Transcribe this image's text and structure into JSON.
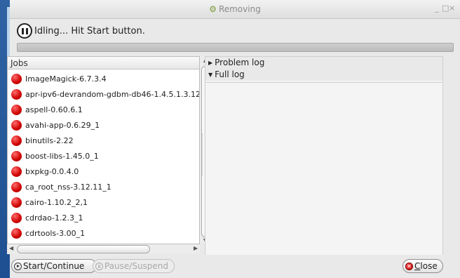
{
  "window": {
    "title": "Removing",
    "title_icon": "gear-removing-icon",
    "controls": {
      "minimize": "_",
      "maximize": "□",
      "close": "×"
    }
  },
  "status": {
    "icon": "pause-circle-icon",
    "text": "Idling... Hit Start button."
  },
  "progress": {
    "fraction": 0.0
  },
  "jobs": {
    "header": "Jobs",
    "items": [
      {
        "label": "ImageMagick-6.7.3.4",
        "status_icon": "red-ball-icon"
      },
      {
        "label": "apr-ipv6-devrandom-gdbm-db46-1.4.5.1.3.12",
        "status_icon": "red-ball-icon"
      },
      {
        "label": "aspell-0.60.6.1",
        "status_icon": "red-ball-icon"
      },
      {
        "label": "avahi-app-0.6.29_1",
        "status_icon": "red-ball-icon"
      },
      {
        "label": "binutils-2.22",
        "status_icon": "red-ball-icon"
      },
      {
        "label": "boost-libs-1.45.0_1",
        "status_icon": "red-ball-icon"
      },
      {
        "label": "bxpkg-0.0.4.0",
        "status_icon": "red-ball-icon"
      },
      {
        "label": "ca_root_nss-3.12.11_1",
        "status_icon": "red-ball-icon"
      },
      {
        "label": "cairo-1.10.2_2,1",
        "status_icon": "red-ball-icon"
      },
      {
        "label": "cdrdao-1.2.3_1",
        "status_icon": "red-ball-icon"
      },
      {
        "label": "cdrtools-3.00_1",
        "status_icon": "red-ball-icon"
      },
      {
        "label": "",
        "status_icon": "red-ball-icon"
      }
    ]
  },
  "logs": {
    "problem_log": "Problem log",
    "full_log": "Full log"
  },
  "buttons": {
    "start": "Start/Continue",
    "pause": "Pause/Suspend",
    "close_prefix": "",
    "close_mnemonic": "C",
    "close_rest": "lose"
  },
  "colors": {
    "job_status": "#d40000",
    "accent": "#6b9bd6"
  }
}
